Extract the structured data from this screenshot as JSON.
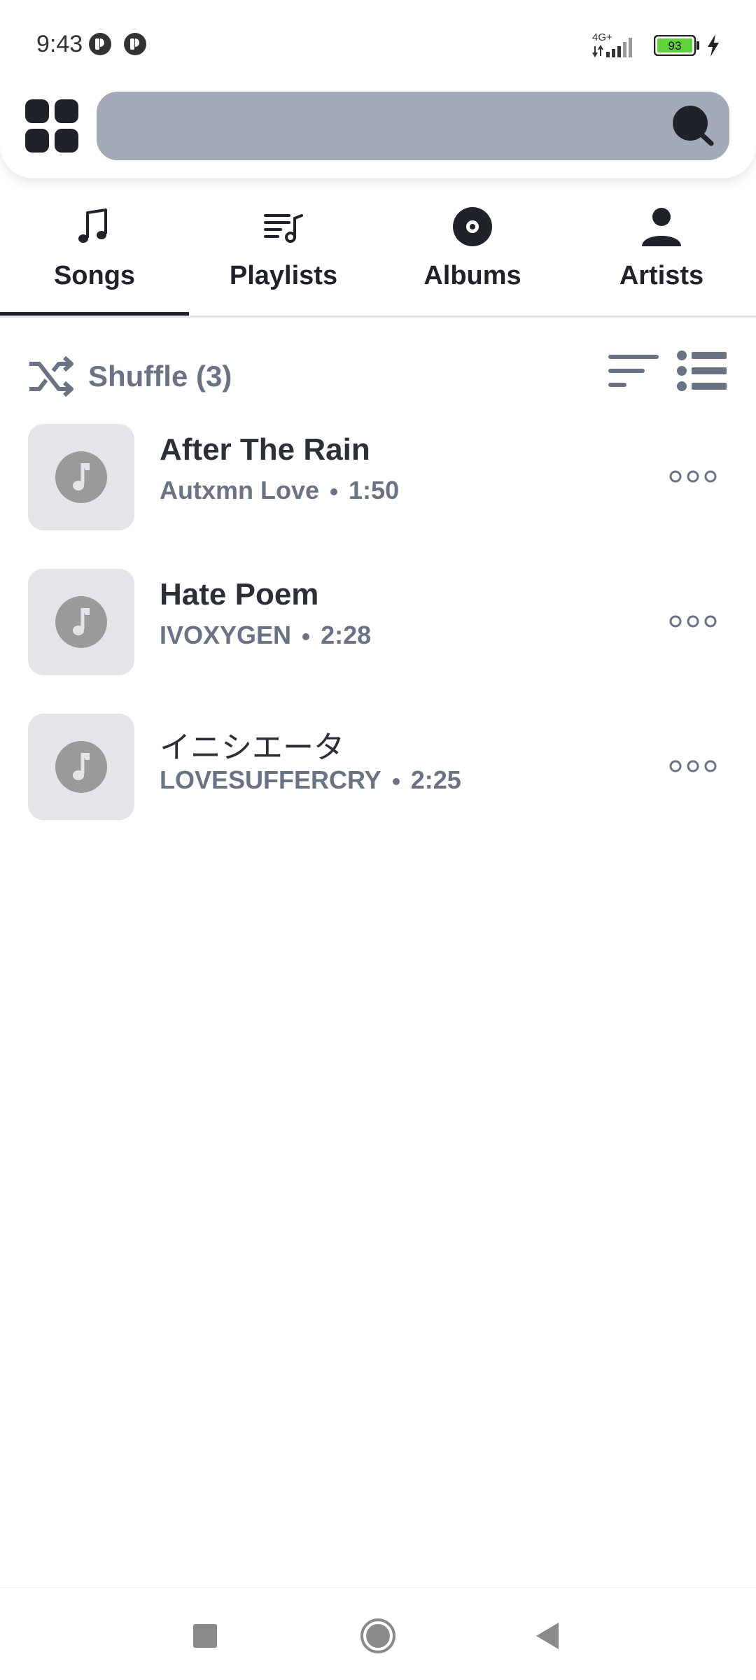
{
  "status_bar": {
    "time": "9:43",
    "network": "4G+",
    "battery": "93"
  },
  "search": {
    "placeholder": "",
    "value": ""
  },
  "tabs": [
    {
      "label": "Songs",
      "icon": "music-note-icon",
      "active": true
    },
    {
      "label": "Playlists",
      "icon": "playlist-icon",
      "active": false
    },
    {
      "label": "Albums",
      "icon": "album-disc-icon",
      "active": false
    },
    {
      "label": "Artists",
      "icon": "person-icon",
      "active": false
    }
  ],
  "shuffle": {
    "label": "Shuffle (3)"
  },
  "songs": [
    {
      "title": "After The Rain",
      "artist": "Autxmn Love",
      "duration": "1:50"
    },
    {
      "title": "Hate Poem",
      "artist": "IVOXYGEN",
      "duration": "2:28"
    },
    {
      "title": "イニシエータ",
      "artist": "LOVESUFFERCRY",
      "duration": "2:25"
    }
  ],
  "colors": {
    "accent": "#1f2329",
    "secondary_text": "#6a7384",
    "search_bg": "#a3a9b7",
    "art_bg": "#e5e4e8",
    "art_icon": "#9a9a9a",
    "battery_fill": "#5fd13a"
  }
}
